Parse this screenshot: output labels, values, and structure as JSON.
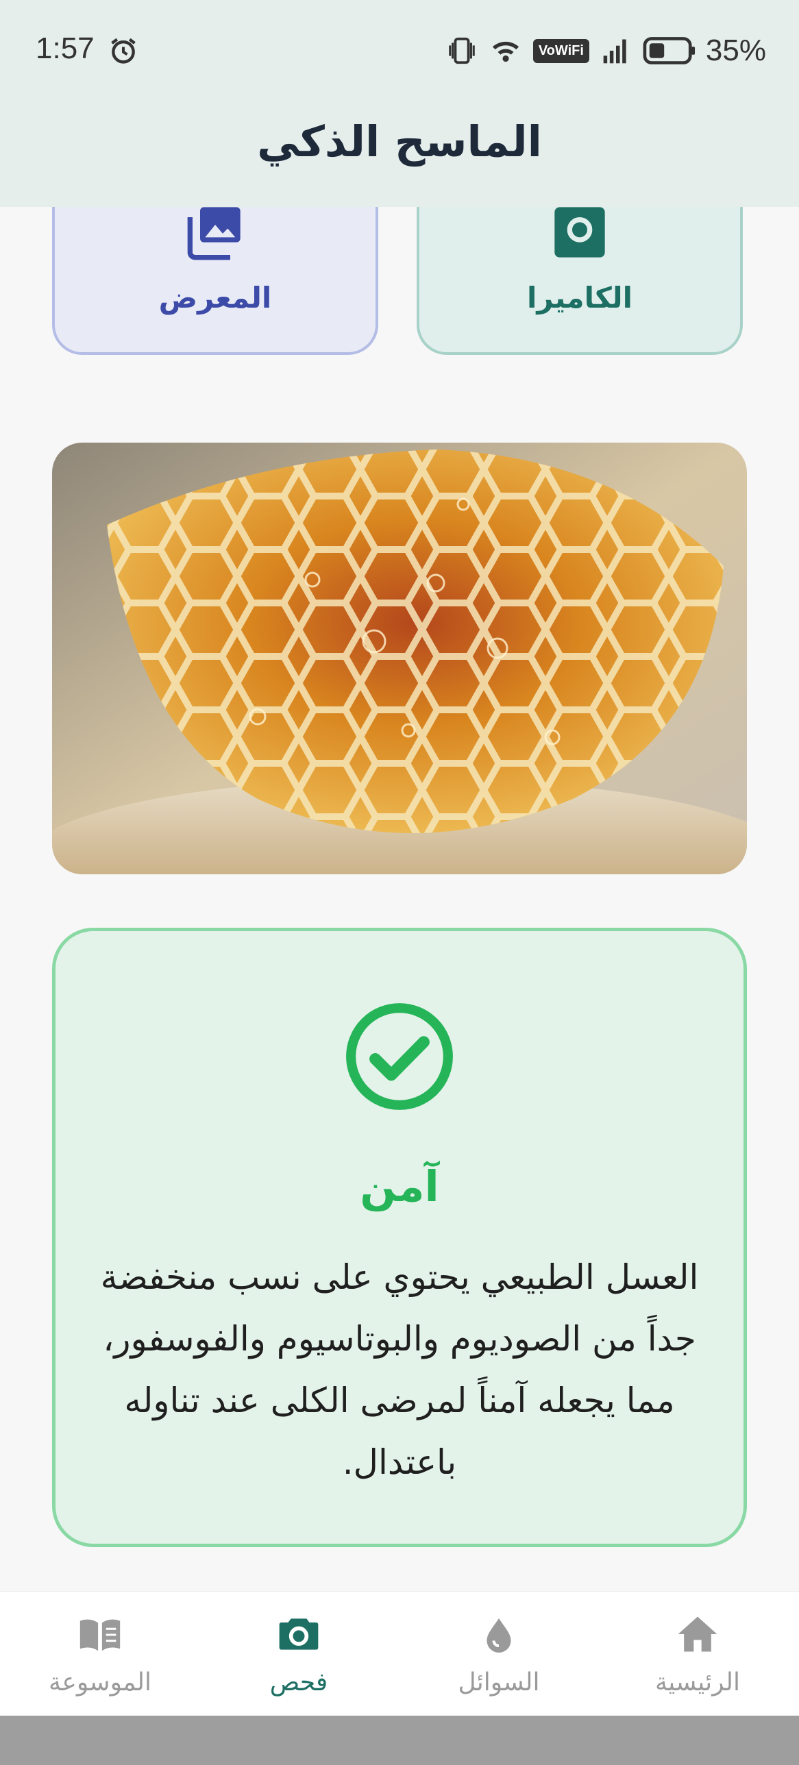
{
  "status_bar": {
    "time": "1:57",
    "vowifi": "VoWiFi",
    "battery": "35%"
  },
  "header": {
    "title": "الماسح الذكي"
  },
  "source_buttons": {
    "gallery": "المعرض",
    "camera": "الكاميرا"
  },
  "result": {
    "status": "آمن",
    "description": "العسل الطبيعي يحتوي على نسب منخفضة جداً من الصوديوم والبوتاسيوم والفوسفور، مما يجعله آمناً لمرضى الكلى عند تناوله باعتدال."
  },
  "bottom_nav": {
    "items": [
      {
        "label": "الموسوعة",
        "icon": "book-icon"
      },
      {
        "label": "فحص",
        "icon": "camera-icon"
      },
      {
        "label": "السوائل",
        "icon": "drop-icon"
      },
      {
        "label": "الرئيسية",
        "icon": "home-icon"
      }
    ],
    "active": "فحص"
  },
  "colors": {
    "accent": "#1d6f63",
    "safe": "#25b558",
    "inactive": "#9a9a9a"
  }
}
